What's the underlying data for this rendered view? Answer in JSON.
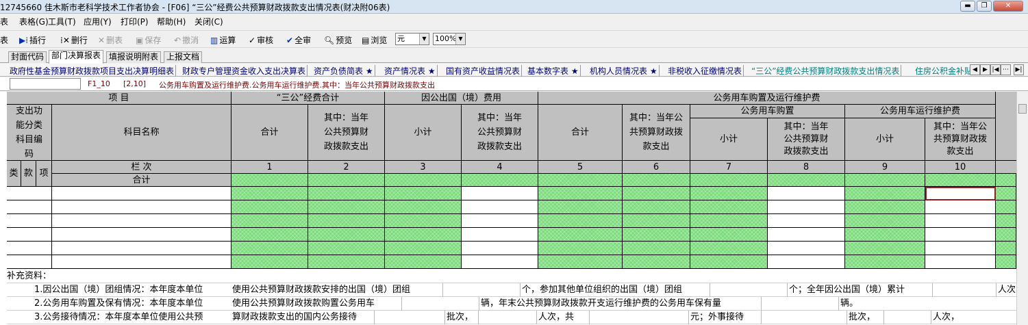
{
  "window": {
    "title": "12745660 佳木斯市老科学技术工作者协会 - [F06] “三公”经费公共预算财政拨款支出情况表(财决附06表)"
  },
  "menu": {
    "items": [
      "表",
      "表格(G)",
      "工具(T)",
      "应用(Y)",
      "打印(P)",
      "帮助(H)",
      "关闭(C)"
    ]
  },
  "toolbar": {
    "buttons": [
      {
        "label": "表",
        "icon": "",
        "enabled": true
      },
      {
        "label": "插行",
        "icon": "insert-row-icon",
        "enabled": true
      },
      {
        "label": "删行",
        "icon": "delete-row-icon",
        "enabled": true
      },
      {
        "label": "删表",
        "icon": "delete-table-icon",
        "enabled": false
      },
      {
        "label": "保存",
        "icon": "save-icon",
        "enabled": false
      },
      {
        "label": "撤消",
        "icon": "undo-icon",
        "enabled": false
      },
      {
        "label": "运算",
        "icon": "calculate-icon",
        "enabled": true
      },
      {
        "label": "审核",
        "icon": "check-icon",
        "enabled": true
      },
      {
        "label": "全审",
        "icon": "check-all-icon",
        "enabled": true
      },
      {
        "label": "预览",
        "icon": "preview-icon",
        "enabled": true
      },
      {
        "label": "浏览",
        "icon": "browse-icon",
        "enabled": true
      }
    ],
    "unit": "元",
    "zoom": "100%"
  },
  "tabs_primary": [
    "封面代码",
    "部门决算报表",
    "填报说明附表",
    "上报文档"
  ],
  "tabs_secondary": [
    "政府性基金预算财政拨款项目支出决算明细表",
    "财政专户管理资金收入支出决算表",
    "资产负债简表 ★",
    "资产情况表 ★",
    "国有资产收益情况表",
    "基本数字表 ★",
    "机构人员情况表 ★",
    "非税收入征缴情况表",
    "“三公”经费公共预算财政拨款支出情况表",
    "住房公积金补贴"
  ],
  "formula_bar": {
    "cell_name": "",
    "ref1": "F1_10",
    "ref2": "[2,10]",
    "description": "公务用车购置及运行维护费.公务用车运行维护费.其中：当年公共预算财政拨款支出"
  },
  "table": {
    "h_item": "项          目",
    "h_sangong": "“三公”经费合计",
    "h_chuguo": "因公出国（境）费用",
    "h_gongwu": "公务用车购置及运行维护费",
    "h_gouzhi": "公务用车购置",
    "h_yunxing": "公务用车运行维护费",
    "h_code": "支出功能分类科目编码",
    "h_name": "科目名称",
    "h_total": "合计",
    "h_subtotal": "小计",
    "h_current": "其中：当年公共预算财政拨款支出",
    "h_col": "栏          次",
    "h_lei": "类",
    "h_kuan": "款",
    "h_xiang": "项",
    "total_row": "合计",
    "col_numbers": [
      "1",
      "2",
      "3",
      "4",
      "5",
      "6",
      "7",
      "8",
      "9",
      "10"
    ]
  },
  "supplement": {
    "title": "补充资料：",
    "line1": [
      "1.因公出国（境）团组情况：本年度本单位",
      "使用公共预算财政拨款安排的出国（境）团组",
      "个，参加其他单位组织的出国（境）团组",
      "个；全年因公出国（境）累计",
      "人次"
    ],
    "line2": [
      "2.公务用车购置及保有情况：本年度本单位",
      "使用公共预算财政拨款购置公务用车",
      "辆，年末公共预算财政拨款开支运行维护费的公务用车保有量",
      "辆。"
    ],
    "line3": [
      "3.公务接待情况：本年度本单位使用公共预",
      "算财政拨款支出的国内公务接待",
      "批次，",
      "人次，共",
      "元；外事接待",
      "批次，",
      "人次，"
    ]
  }
}
